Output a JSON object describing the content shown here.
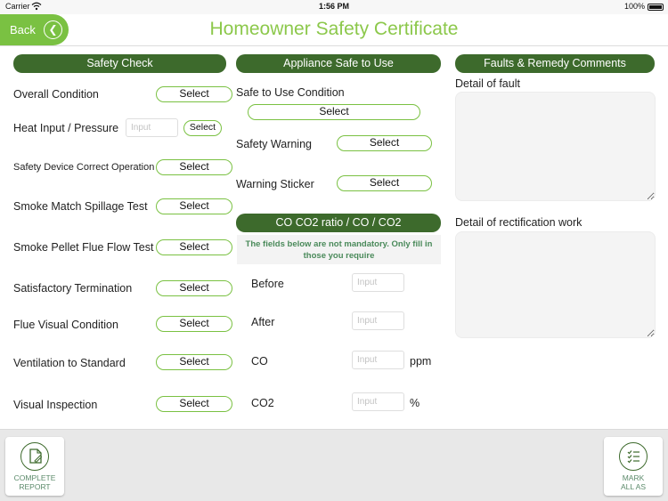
{
  "status_bar": {
    "carrier": "Carrier",
    "time": "1:56 PM",
    "battery": "100%"
  },
  "header": {
    "back_label": "Back",
    "back_icon": "chevron-left-icon",
    "title": "Homeowner Safety Certificate"
  },
  "colors": {
    "accent_green": "#7ac142",
    "dark_green": "#3d6a2c",
    "title_green": "#8cc84b"
  },
  "safety_check": {
    "heading": "Safety Check",
    "select_label": "Select",
    "input_placeholder": "Input",
    "rows": [
      {
        "label": "Overall Condition"
      },
      {
        "label": "Heat Input / Pressure"
      },
      {
        "label": "Safety Device Correct Operation"
      },
      {
        "label": "Smoke Match Spillage Test"
      },
      {
        "label": "Smoke Pellet Flue Flow Test"
      },
      {
        "label": "Satisfactory Termination"
      },
      {
        "label": "Flue Visual Condition"
      },
      {
        "label": "Ventilation to Standard"
      },
      {
        "label": "Visual Inspection"
      }
    ]
  },
  "appliance": {
    "heading": "Appliance Safe to Use",
    "safe_to_use_label": "Safe to Use Condition",
    "safety_warning_label": "Safety Warning",
    "warning_sticker_label": "Warning Sticker",
    "select_label": "Select"
  },
  "co_ratio": {
    "heading": "CO CO2 ratio / CO / CO2",
    "note": "The fields below are not mandatory. Only fill in those you require",
    "input_placeholder": "Input",
    "rows": [
      {
        "label": "Before",
        "unit": ""
      },
      {
        "label": "After",
        "unit": ""
      },
      {
        "label": "CO",
        "unit": "ppm"
      },
      {
        "label": "CO2",
        "unit": "%"
      }
    ]
  },
  "faults": {
    "heading": "Faults & Remedy Comments",
    "fault_label": "Detail of fault",
    "rectification_label": "Detail of rectification work"
  },
  "footer": {
    "complete_report": {
      "line1": "COMPLETE",
      "line2": "REPORT",
      "icon": "document-edit-icon"
    },
    "mark_all": {
      "line1": "MARK",
      "line2": "ALL AS",
      "icon": "checklist-icon"
    }
  }
}
